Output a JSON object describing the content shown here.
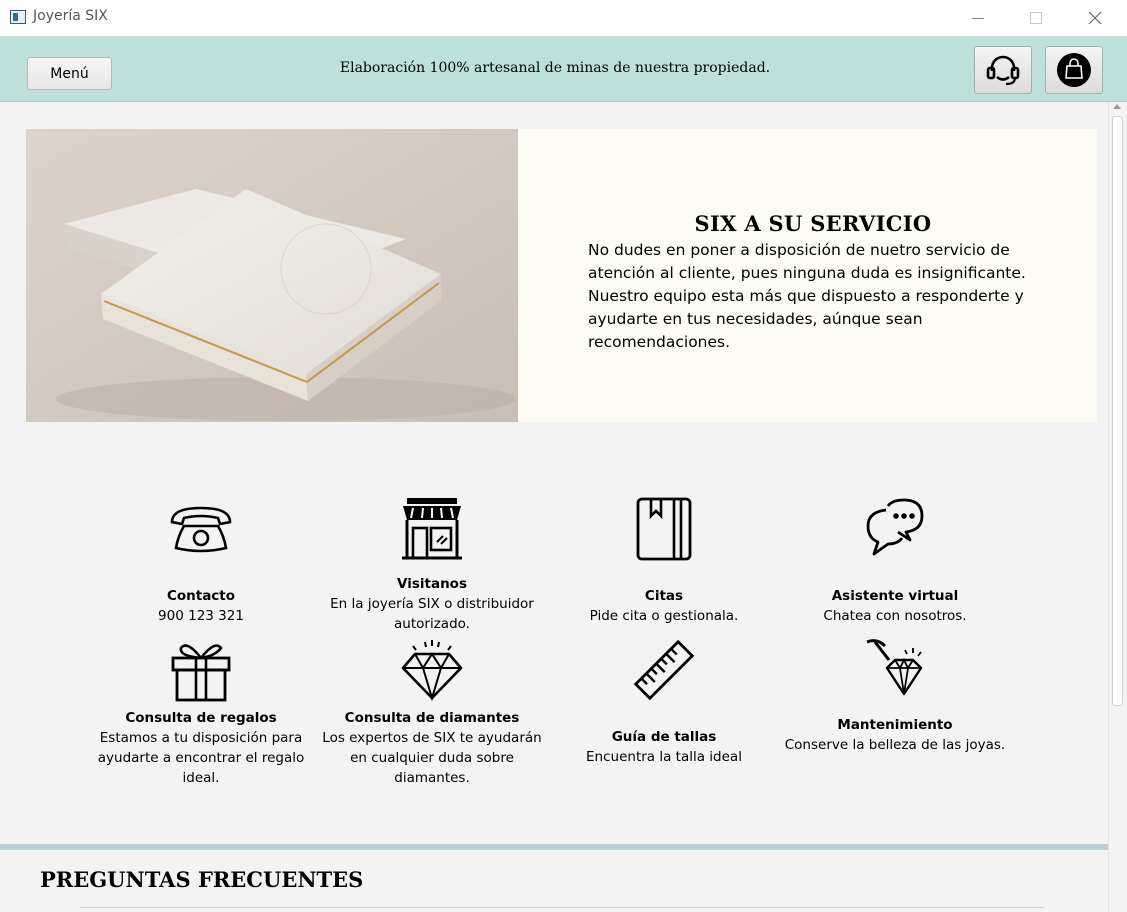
{
  "window": {
    "title": "Joyería SIX"
  },
  "topbar": {
    "menu_label": "Menú",
    "tagline": "Elaboración 100% artesanal de minas de nuestra propiedad.",
    "support_icon": "headset-icon",
    "bag_icon": "shopping-bag-icon"
  },
  "hero": {
    "title": "SIX A SU SERVICIO",
    "text": "No dudes en poner a disposición de nuetro servicio de atención al cliente, pues ninguna duda es insignificante. Nuestro equipo esta más que dispuesto a responderte y ayudarte en tus necesidades, aúnque sean recomendaciones."
  },
  "services": [
    {
      "icon": "telephone-icon",
      "title": "Contacto",
      "text": "900 123 321"
    },
    {
      "icon": "store-icon",
      "title": "Visitanos",
      "text": "En la joyería SIX o distribuidor autorizado."
    },
    {
      "icon": "notebook-icon",
      "title": "Citas",
      "text": "Pide cita o gestionala."
    },
    {
      "icon": "chat-icon",
      "title": "Asistente virtual",
      "text": "Chatea con nosotros."
    },
    {
      "icon": "gift-icon",
      "title": "Consulta de regalos",
      "text": "Estamos a tu disposición para ayudarte a encontrar el regalo ideal."
    },
    {
      "icon": "diamond-icon",
      "title": "Consulta de diamantes",
      "text": "Los expertos de SIX te ayudarán en cualquier duda sobre diamantes."
    },
    {
      "icon": "ruler-icon",
      "title": "Guía de tallas",
      "text": "Encuentra la talla ideal"
    },
    {
      "icon": "pickaxe-diamond-icon",
      "title": "Mantenimiento",
      "text": "Conserve la belleza de las joyas."
    }
  ],
  "faq": {
    "title": "PREGUNTAS FRECUENTES"
  },
  "colors": {
    "topbar": "#bde0db",
    "hero_panel": "#fdfcf4",
    "background": "#f3f3f3"
  }
}
